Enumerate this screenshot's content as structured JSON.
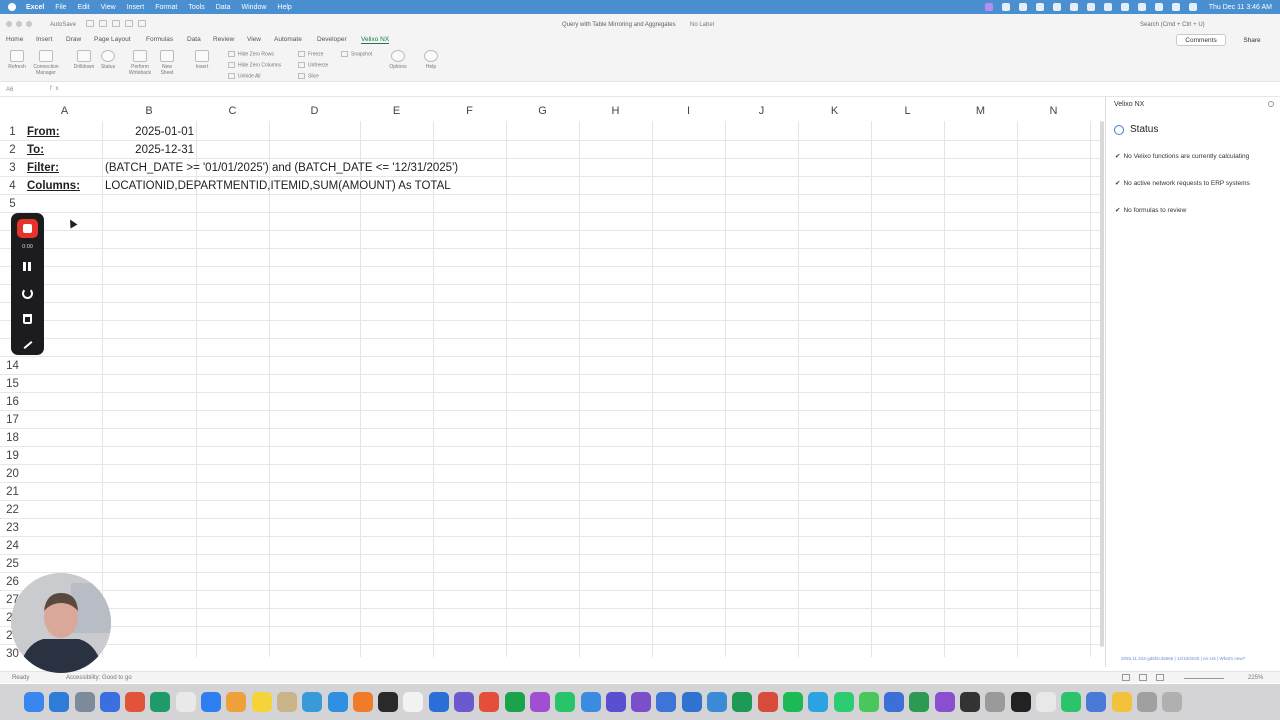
{
  "menubar": {
    "items": [
      "Excel",
      "File",
      "Edit",
      "View",
      "Insert",
      "Format",
      "Tools",
      "Data",
      "Window",
      "Help"
    ],
    "clock": "Thu Dec 11  3:46 AM"
  },
  "titlebar": {
    "autosave": "AutoSave",
    "title": "Query with Table Mirroring and Aggregates",
    "label": "No Label",
    "search_placeholder": "Search (Cmd + Ctrl + U)"
  },
  "ribbon": {
    "tabs": [
      "Home",
      "Insert",
      "Draw",
      "Page Layout",
      "Formulas",
      "Data",
      "Review",
      "View",
      "Automate",
      "Developer",
      "Velixo NX"
    ],
    "active_tab": "Velixo NX",
    "comments": "Comments",
    "share": "Share",
    "buttons": {
      "refresh": "Refresh",
      "connection_manager": "Connection Manager",
      "drilldown": "Drilldown",
      "status": "Status",
      "perform_writeback": "Perform Writeback",
      "new_sheet": "New Sheet",
      "insert": "Insert",
      "options": "Options",
      "help": "Help"
    },
    "small": {
      "hide_zero_rows": "Hide Zero Rows",
      "hide_zero_columns": "Hide Zero Columns",
      "unhide_all": "Unhide All",
      "freeze": "Freeze",
      "unfreeze": "Unfreeze",
      "slice": "Slice",
      "snapshot": "Snapshot"
    }
  },
  "formula_bar": {
    "name_box": "A6",
    "fx": "fx"
  },
  "sheet": {
    "columns": [
      "A",
      "B",
      "C",
      "D",
      "E",
      "F",
      "G",
      "H",
      "I",
      "J",
      "K",
      "L",
      "M",
      "N"
    ],
    "rows": [
      "1",
      "2",
      "3",
      "4",
      "5",
      "14",
      "15",
      "16",
      "17",
      "18",
      "19",
      "20",
      "21",
      "22",
      "23",
      "24",
      "25",
      "26",
      "27",
      "28",
      "29",
      "30"
    ],
    "cells": {
      "a1": "From:",
      "b1": "2025-01-01",
      "a2": "To:",
      "b2": "2025-12-31",
      "a3": "Filter:",
      "b3": "(BATCH_DATE >= '01/01/2025') and (BATCH_DATE <= '12/31/2025')",
      "a4": "Columns:",
      "b4": "LOCATIONID,DEPARTMENTID,ITEMID,SUM(AMOUNT) As TOTAL"
    }
  },
  "pane": {
    "title": "Velixo NX",
    "status_heading": "Status",
    "items": [
      "No Velixo functions are currently calculating",
      "No active network requests to ERP systems",
      "No formulas to review"
    ],
    "footer": "2025.11.332-gd5f2c35566 | 12/10/2025 | en-US | What's new?"
  },
  "recorder": {
    "time": "0:00"
  },
  "statusbar": {
    "ready": "Ready",
    "accessibility": "Accessibility: Good to go",
    "zoom": "225%"
  },
  "colors": {
    "accent": "#1e7a48",
    "menubar": "#4a8fd0",
    "record": "#e6342a"
  }
}
